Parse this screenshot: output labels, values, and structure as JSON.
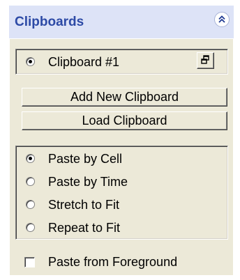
{
  "panel": {
    "title": "Clipboards",
    "collapse_icon": "double-chevron-up-icon"
  },
  "clipboard_selector": {
    "label": "Clipboard #1",
    "selected": true,
    "restore_icon": "restore-window-icon"
  },
  "buttons": {
    "add_label": "Add New Clipboard",
    "load_label": "Load Clipboard"
  },
  "paste_modes": [
    {
      "label": "Paste by Cell",
      "selected": true
    },
    {
      "label": "Paste by Time",
      "selected": false
    },
    {
      "label": "Stretch to Fit",
      "selected": false
    },
    {
      "label": "Repeat to Fit",
      "selected": false
    }
  ],
  "paste_from_foreground": {
    "label": "Paste from Foreground",
    "checked": false
  },
  "colors": {
    "header_bg": "#dde3f7",
    "title_color": "#2d4aa6",
    "body_bg": "#ece9d8"
  }
}
